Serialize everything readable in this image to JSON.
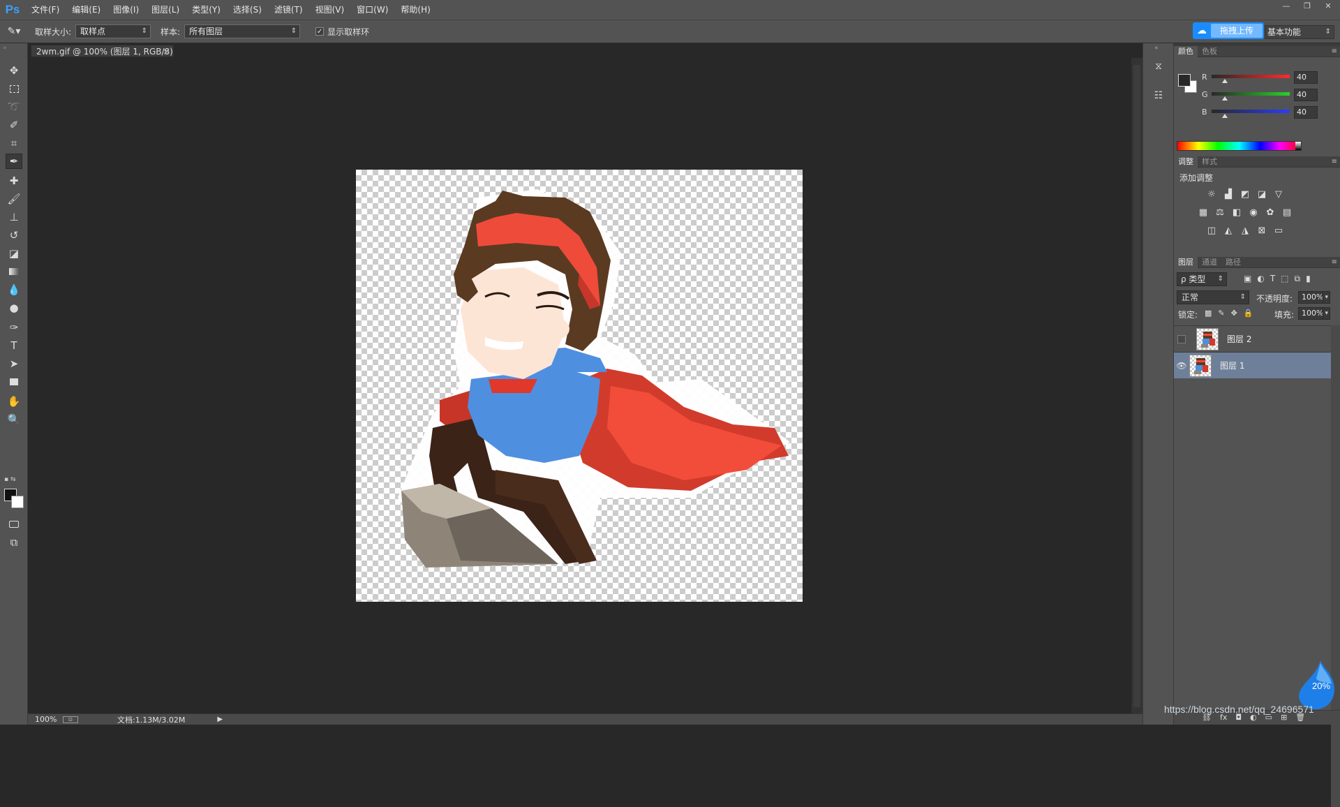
{
  "menubar": {
    "logo": "Ps",
    "items": [
      "文件(F)",
      "编辑(E)",
      "图像(I)",
      "图层(L)",
      "类型(Y)",
      "选择(S)",
      "滤镜(T)",
      "视图(V)",
      "窗口(W)",
      "帮助(H)"
    ],
    "window_controls": [
      "—",
      "❐",
      "✕"
    ]
  },
  "options": {
    "sample_size_label": "取样大小:",
    "sample_size_value": "取样点",
    "sample_label": "样本:",
    "sample_value": "所有图层",
    "show_ring_label": "显示取样环",
    "show_ring_checked": true,
    "upload_label": "拖拽上传",
    "workspace": "基本功能"
  },
  "document": {
    "tab_title": "2wm.gif @ 100% (图层 1, RGB/8)",
    "close": "×"
  },
  "status": {
    "zoom": "100%",
    "doc_info": "文档:1.13M/3.02M"
  },
  "color_panel": {
    "tabs": [
      "颜色",
      "色板"
    ],
    "channels": [
      {
        "label": "R",
        "value": "40",
        "color": "#ff2a2a"
      },
      {
        "label": "G",
        "value": "40",
        "color": "#2ad12a"
      },
      {
        "label": "B",
        "value": "40",
        "color": "#2a3cff"
      }
    ]
  },
  "adjust_panel": {
    "tabs": [
      "调整",
      "样式"
    ],
    "title": "添加调整"
  },
  "layers_panel": {
    "tabs": [
      "图层",
      "通道",
      "路径"
    ],
    "filter": "ρ 类型",
    "blend_mode": "正常",
    "opacity_label": "不透明度:",
    "opacity": "100%",
    "lock_label": "锁定:",
    "fill_label": "填充:",
    "fill": "100%",
    "layers": [
      {
        "name": "图层 2",
        "visible": false,
        "selected": false
      },
      {
        "name": "图层 1",
        "visible": true,
        "selected": true
      }
    ]
  },
  "overlay": {
    "watermark": "https://blog.csdn.net/qq_24696571",
    "net_percent": "20%"
  }
}
